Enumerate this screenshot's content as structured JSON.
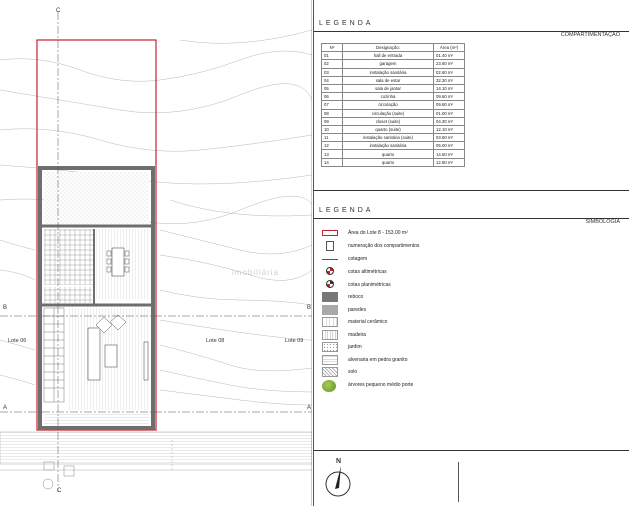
{
  "plan": {
    "section_markers": [
      "C",
      "C",
      "B",
      "B",
      "A",
      "A"
    ],
    "lots": [
      "Lote 06",
      "Lote 08",
      "Lote 09"
    ],
    "watermark": "imobiliária"
  },
  "legend_rooms": {
    "title": "LEGENDA",
    "section": "COMPARTIMENTAÇÃO",
    "headers": [
      "Nº",
      "Designação:",
      "Área (m²)"
    ],
    "rows": [
      [
        "01",
        "hall de entrada",
        "01.40 m²"
      ],
      [
        "02",
        "garagem",
        "23.60 m²"
      ],
      [
        "03",
        "instalação sanitária",
        "02.60 m²"
      ],
      [
        "04",
        "sala de estar",
        "32.30 m²"
      ],
      [
        "05",
        "sala de jantar",
        "14.10 m²"
      ],
      [
        "06",
        "cozinha",
        "09.60 m²"
      ],
      [
        "07",
        "circulação",
        "09.60 m²"
      ],
      [
        "08",
        "circulação (suite)",
        "01.00 m²"
      ],
      [
        "09",
        "closet (suite)",
        "04.30 m²"
      ],
      [
        "10",
        "quarto (suite)",
        "12.10 m²"
      ],
      [
        "11",
        "instalação sanitária (suite)",
        "03.60 m²"
      ],
      [
        "12",
        "instalação sanitária",
        "05.00 m²"
      ],
      [
        "13",
        "quarto",
        "14.50 m²"
      ],
      [
        "14",
        "quarto",
        "12.80 m²"
      ]
    ]
  },
  "legend_symbols": {
    "title": "LEGENDA",
    "section": "SIMBOLOGIA",
    "items": [
      {
        "label": "Área do Lote 8 - 153.00 m²",
        "icon": "lot-boundary-icon"
      },
      {
        "label": "numeração dos compartimentos",
        "icon": "room-number-icon"
      },
      {
        "label": "cotagem",
        "icon": "dimension-icon"
      },
      {
        "label": "cotas altimétricas",
        "icon": "elevation-mark-icon"
      },
      {
        "label": "cotas planimétricas",
        "icon": "plan-mark-icon"
      },
      {
        "label": "reboco",
        "icon": "render-swatch"
      },
      {
        "label": "paredes",
        "icon": "walls-swatch"
      },
      {
        "label": "material cerâmico",
        "icon": "ceramic-swatch"
      },
      {
        "label": "madeira",
        "icon": "wood-swatch"
      },
      {
        "label": "jardim",
        "icon": "garden-swatch"
      },
      {
        "label": "alvenaria em pedra granito",
        "icon": "granite-swatch"
      },
      {
        "label": "solo",
        "icon": "soil-swatch"
      },
      {
        "label": "árvores pequeno médio porte",
        "icon": "tree-icon"
      }
    ]
  },
  "north_label": "N",
  "colors": {
    "accent": "#c8202a",
    "wall": "#6e6e6e",
    "render": "#777777",
    "walls_light": "#a9a9a9"
  }
}
